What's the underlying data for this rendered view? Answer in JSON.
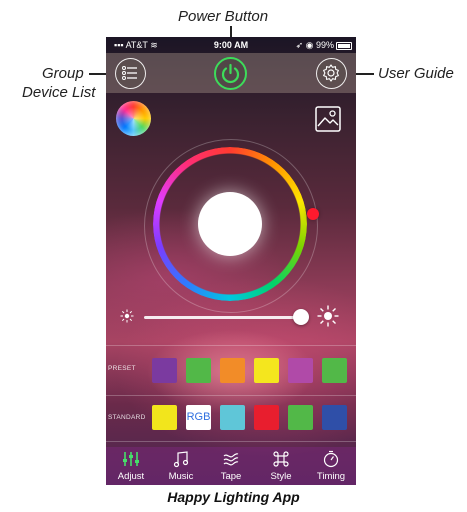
{
  "annotations": {
    "power_button": "Power Button",
    "group_device_list_line1": "Group",
    "group_device_list_line2": "Device List",
    "user_guide": "User Guide",
    "caption": "Happy Lighting App"
  },
  "status_bar": {
    "carrier": "AT&T",
    "time": "9:00 AM",
    "battery": "99%"
  },
  "top_bar": {
    "menu_icon": "list-icon",
    "power_icon": "power-icon",
    "settings_icon": "gear-icon"
  },
  "color_picker": {
    "selected_color": "#ff1a2e",
    "center_color": "#ffffff"
  },
  "brightness": {
    "value_fraction": 0.95
  },
  "preset": {
    "label": "PRESET",
    "colors": [
      "#7b3aa0",
      "#52b848",
      "#f28c28",
      "#f4e61e",
      "#b04aa8",
      "#52b848"
    ]
  },
  "standard": {
    "label": "STANDARD",
    "rgb_label": "RGB",
    "colors": [
      "#f2e51c",
      "RGB",
      "#5fc6d8",
      "#e81e2e",
      "#52b848",
      "#2f4fa8"
    ]
  },
  "tabs": [
    {
      "label": "Adjust",
      "icon": "sliders-icon",
      "active": true
    },
    {
      "label": "Music",
      "icon": "music-note-icon",
      "active": false
    },
    {
      "label": "Tape",
      "icon": "tape-icon",
      "active": false
    },
    {
      "label": "Style",
      "icon": "command-icon",
      "active": false
    },
    {
      "label": "Timing",
      "icon": "timer-icon",
      "active": false
    }
  ],
  "colors": {
    "accent_green": "#3ddc5a",
    "active_tab": "#45e06a"
  }
}
